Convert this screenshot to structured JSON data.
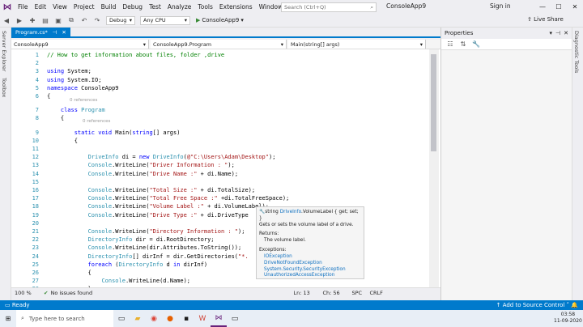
{
  "menubar": {
    "items": [
      "File",
      "Edit",
      "View",
      "Project",
      "Build",
      "Debug",
      "Test",
      "Analyze",
      "Tools",
      "Extensions",
      "Window",
      "Help"
    ],
    "search_placeholder": "Search (Ctrl+Q)",
    "solution_name": "ConsoleApp9",
    "signin": "Sign in"
  },
  "toolbar": {
    "config": "Debug",
    "platform": "Any CPU",
    "run_target": "ConsoleApp9",
    "live_share": "Live Share"
  },
  "side_tabs": {
    "left": [
      "Server Explorer",
      "Toolbox"
    ],
    "right": [
      "Diagnostic Tools"
    ]
  },
  "document": {
    "tab_label": "Program.cs*",
    "nav": [
      "ConsoleApp9",
      "ConsoleApp9.Program",
      "Main(string[] args)"
    ]
  },
  "code_lines": [
    {
      "n": "1",
      "text": "// How to get information about files, folder ,drive"
    },
    {
      "n": "2",
      "text": ""
    },
    {
      "n": "3",
      "text": "using System;"
    },
    {
      "n": "4",
      "text": "using System.IO;"
    },
    {
      "n": "5",
      "text": "namespace ConsoleApp9"
    },
    {
      "n": "6",
      "text": "{"
    },
    {
      "n": "7",
      "text": "    class Program"
    },
    {
      "n": "8",
      "text": "    {"
    },
    {
      "n": "9",
      "text": "        static void Main(string[] args)"
    },
    {
      "n": "10",
      "text": "        {"
    },
    {
      "n": "11",
      "text": ""
    },
    {
      "n": "12",
      "text": "            DriveInfo di = new DriveInfo(@\"C:\\Users\\Adam\\Desktop\");"
    },
    {
      "n": "13",
      "text": "            Console.WriteLine(\"Driver Information : \");"
    },
    {
      "n": "14",
      "text": "            Console.WriteLine(\"Drive Name :\" + di.Name);"
    },
    {
      "n": "15",
      "text": ""
    },
    {
      "n": "16",
      "text": "            Console.WriteLine(\"Total Size :\" + di.TotalSize);"
    },
    {
      "n": "17",
      "text": "            Console.WriteLine(\"Total Free Space :\" +di.TotalFreeSpace);"
    },
    {
      "n": "18",
      "text": "            Console.WriteLine(\"Volume Label :\" + di.VolumeLabel);"
    },
    {
      "n": "19",
      "text": "            Console.WriteLine(\"Drive Type :\" + di.DriveType"
    },
    {
      "n": "20",
      "text": ""
    },
    {
      "n": "21",
      "text": "            Console.WriteLine(\"Directory Information : \");"
    },
    {
      "n": "22",
      "text": "            DirectoryInfo dir = di.RootDirectory;"
    },
    {
      "n": "23",
      "text": "            Console.WriteLine(dir.Attributes.ToString());"
    },
    {
      "n": "24",
      "text": "            DirectoryInfo[] dirInf = dir.GetDirectories(\"*."
    },
    {
      "n": "25",
      "text": "            foreach (DirectoryInfo d in dirInf)"
    },
    {
      "n": "26",
      "text": "            {"
    },
    {
      "n": "27",
      "text": "                Console.WriteLine(d.Name);"
    },
    {
      "n": "28",
      "text": "            }"
    }
  ],
  "codelens": {
    "class_refs": "0 references",
    "main_refs": "0 references"
  },
  "tooltip": {
    "signature_pre": "string ",
    "signature_type": "DriveInfo",
    "signature_post": ".VolumeLabel { get; set; }",
    "summary": "Gets or sets the volume label of a drive.",
    "returns_label": "Returns:",
    "returns_text": "The volume label.",
    "exceptions_label": "Exceptions:",
    "exceptions": [
      "IOException",
      "DriveNotFoundException",
      "System.Security.SecurityException",
      "UnauthorizedAccessException"
    ]
  },
  "editor_status": {
    "zoom": "100 %",
    "issues": "No issues found",
    "line": "Ln: 13",
    "col": "Ch: 56",
    "mode": "SPC",
    "eol": "CRLF"
  },
  "properties": {
    "title": "Properties"
  },
  "statusbar": {
    "left": "Ready",
    "right": "Add to Source Control"
  },
  "taskbar": {
    "search_placeholder": "Type here to search",
    "time": "03:58",
    "date": "11-09-2020"
  },
  "colors": {
    "accent": "#007acc",
    "keyword": "#0000ff",
    "type": "#2b91af",
    "string": "#a31515",
    "comment": "#008000"
  }
}
